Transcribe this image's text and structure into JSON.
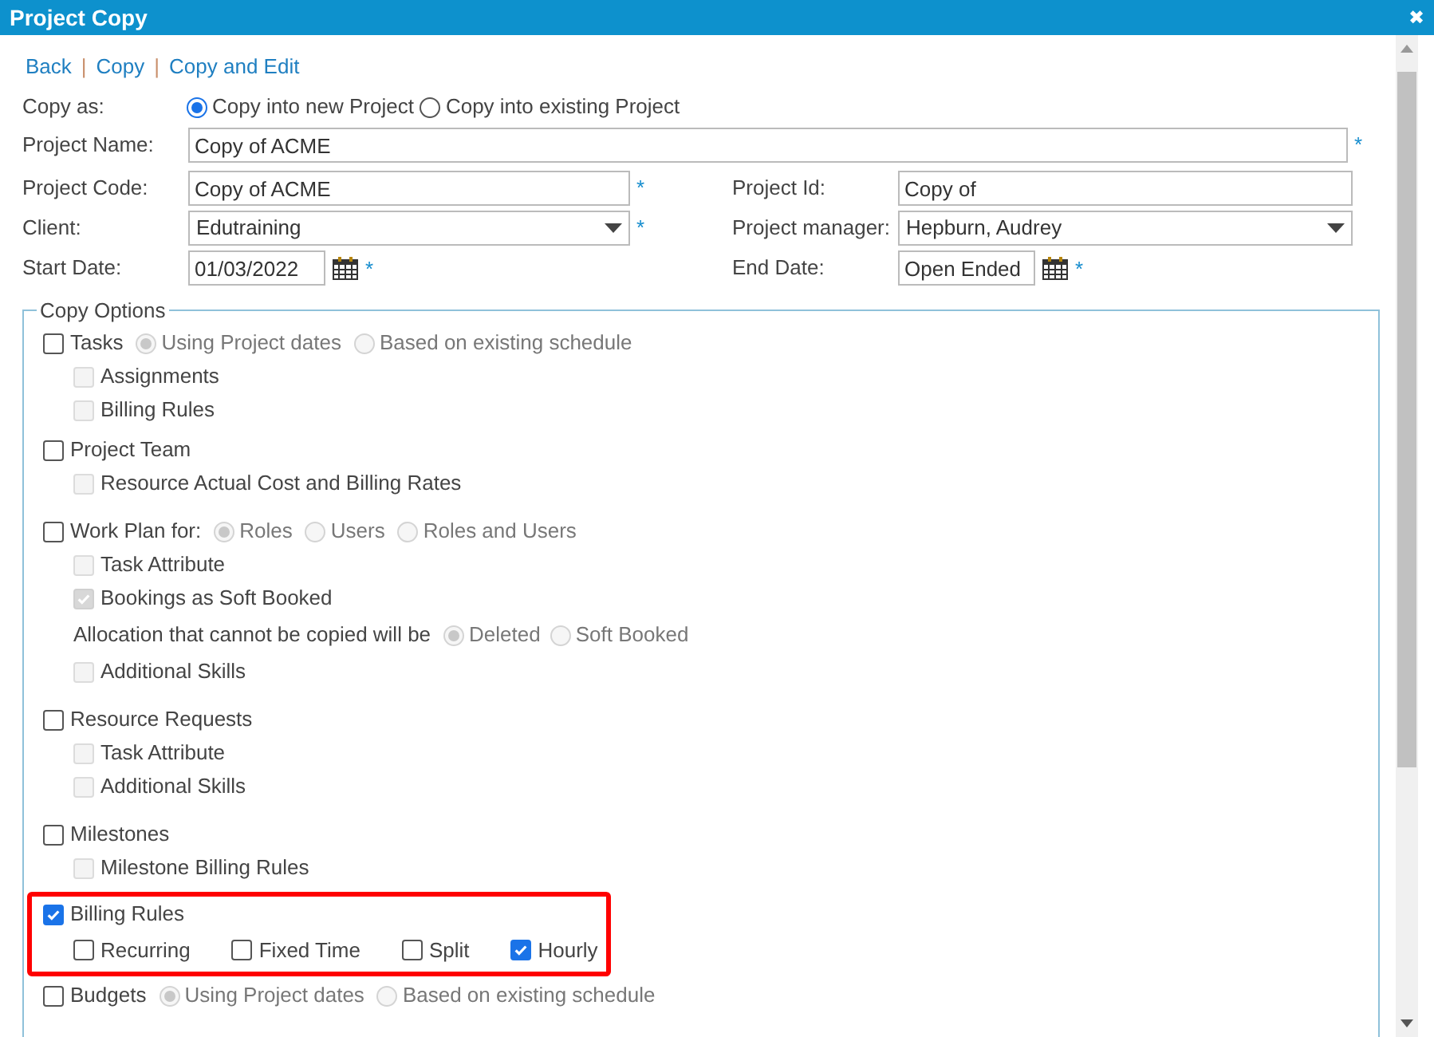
{
  "window": {
    "title": "Project Copy",
    "close": "✖"
  },
  "links": [
    {
      "kind": "link",
      "text": "Back"
    },
    {
      "kind": "separator",
      "text": "|"
    },
    {
      "kind": "link",
      "text": "Copy"
    },
    {
      "kind": "separator",
      "text": "|"
    },
    {
      "kind": "link",
      "text": "Copy and Edit"
    }
  ],
  "copy_as": {
    "label": "Copy as:",
    "options": [
      {
        "label": "Copy into new Project",
        "selected": true
      },
      {
        "label": "Copy into existing Project",
        "selected": false
      }
    ]
  },
  "fields": {
    "project_name": {
      "label": "Project Name:",
      "value": "Copy of ACME",
      "required_mark": "*"
    },
    "project_code": {
      "label": "Project Code:",
      "value": "Copy of ACME",
      "required_mark": "*"
    },
    "project_id": {
      "label": "Project Id:",
      "value": "Copy of"
    },
    "client": {
      "label": "Client:",
      "value": "Edutraining",
      "required_mark": "*"
    },
    "project_manager": {
      "label": "Project manager:",
      "value": "Hepburn, Audrey"
    },
    "start_date": {
      "label": "Start Date:",
      "value": "01/03/2022",
      "required_mark": "*"
    },
    "end_date": {
      "label": "End Date:",
      "value": "Open Ended",
      "required_mark": "*"
    }
  },
  "copy_options": {
    "title": "Copy Options",
    "sections": [
      {
        "label": "Tasks",
        "checked": false,
        "highlighted": false,
        "options": [
          {
            "label": "Using Project dates",
            "selected": true
          },
          {
            "label": "Based on existing schedule",
            "selected": false
          }
        ],
        "children": [
          {
            "kind": "checkbox",
            "label": "Assignments",
            "checked": false,
            "disabled": true
          },
          {
            "kind": "checkbox",
            "label": "Billing Rules",
            "checked": false,
            "disabled": true
          }
        ]
      },
      {
        "label": "Project Team",
        "checked": false,
        "highlighted": false,
        "children": [
          {
            "kind": "checkbox",
            "label": "Resource Actual Cost and Billing Rates",
            "checked": false,
            "disabled": true
          }
        ]
      },
      {
        "label": "Work Plan for:",
        "checked": false,
        "highlighted": false,
        "options": [
          {
            "label": "Roles",
            "selected": true
          },
          {
            "label": "Users",
            "selected": false
          },
          {
            "label": "Roles and Users",
            "selected": false
          }
        ],
        "children": [
          {
            "kind": "checkbox",
            "label": "Task Attribute",
            "checked": false,
            "disabled": true
          },
          {
            "kind": "checkbox",
            "label": "Bookings as Soft Booked",
            "checked": true,
            "disabled": true
          },
          {
            "kind": "radio_line",
            "label": "Allocation that cannot be copied will be",
            "options": [
              {
                "label": "Deleted",
                "selected": true
              },
              {
                "label": "Soft Booked",
                "selected": false
              }
            ]
          },
          {
            "kind": "checkbox",
            "label": "Additional Skills",
            "checked": false,
            "disabled": true
          }
        ]
      },
      {
        "label": "Resource Requests",
        "checked": false,
        "highlighted": false,
        "children": [
          {
            "kind": "checkbox",
            "label": "Task Attribute",
            "checked": false,
            "disabled": true
          },
          {
            "kind": "checkbox",
            "label": "Additional Skills",
            "checked": false,
            "disabled": true
          }
        ]
      },
      {
        "label": "Milestones",
        "checked": false,
        "highlighted": false,
        "children": [
          {
            "kind": "checkbox",
            "label": "Milestone Billing Rules",
            "checked": false,
            "disabled": true
          }
        ]
      },
      {
        "label": "Billing Rules",
        "checked": true,
        "highlighted": true,
        "children": [
          {
            "kind": "checkbox_row",
            "items": [
              {
                "label": "Recurring",
                "checked": false
              },
              {
                "label": "Fixed Time",
                "checked": false
              },
              {
                "label": "Split",
                "checked": false
              },
              {
                "label": "Hourly",
                "checked": true
              }
            ]
          }
        ]
      },
      {
        "label": "Budgets",
        "checked": false,
        "highlighted": false,
        "options": [
          {
            "label": "Using Project dates",
            "selected": true
          },
          {
            "label": "Based on existing schedule",
            "selected": false
          }
        ]
      }
    ]
  }
}
